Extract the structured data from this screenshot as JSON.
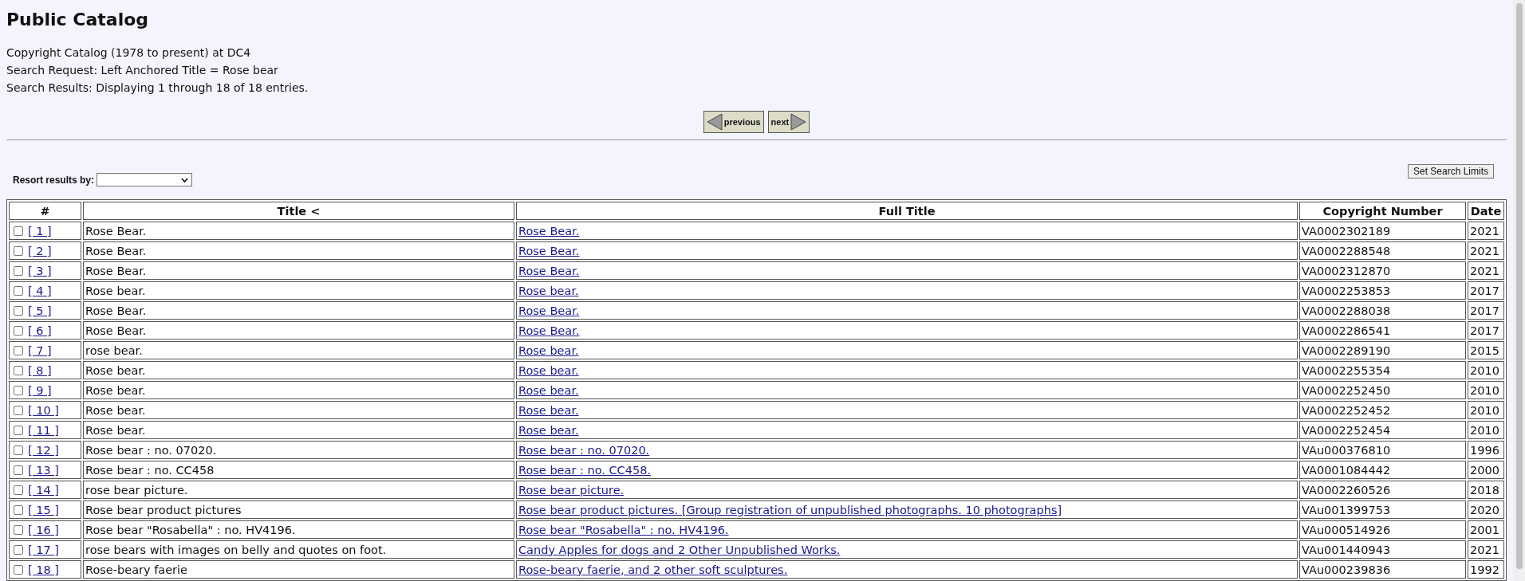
{
  "title": "Public Catalog",
  "info_lines": [
    "Copyright Catalog (1978 to present) at DC4",
    "Search Request: Left Anchored Title = Rose bear",
    "Search Results: Displaying 1 through 18 of 18 entries."
  ],
  "pager": {
    "previous": "previous",
    "next": "next"
  },
  "resort": {
    "label": "Resort results by:"
  },
  "limits_button": "Set Search Limits",
  "table": {
    "columns": [
      "#",
      "Title <",
      "Full Title",
      "Copyright Number",
      "Date"
    ],
    "rows": [
      {
        "checked": false,
        "index": "[ 1 ]",
        "title": "Rose Bear.",
        "full_title": "Rose Bear.",
        "number": "VA0002302189",
        "date": "2021"
      },
      {
        "checked": false,
        "index": "[ 2 ]",
        "title": "Rose Bear.",
        "full_title": "Rose Bear.",
        "number": "VA0002288548",
        "date": "2021"
      },
      {
        "checked": false,
        "index": "[ 3 ]",
        "title": "Rose Bear.",
        "full_title": "Rose Bear.",
        "number": "VA0002312870",
        "date": "2021"
      },
      {
        "checked": false,
        "index": "[ 4 ]",
        "title": "Rose bear.",
        "full_title": "Rose bear.",
        "number": "VA0002253853",
        "date": "2017"
      },
      {
        "checked": false,
        "index": "[ 5 ]",
        "title": "Rose Bear.",
        "full_title": "Rose Bear.",
        "number": "VA0002288038",
        "date": "2017"
      },
      {
        "checked": false,
        "index": "[ 6 ]",
        "title": "Rose Bear.",
        "full_title": "Rose Bear.",
        "number": "VA0002286541",
        "date": "2017"
      },
      {
        "checked": false,
        "index": "[ 7 ]",
        "title": "rose bear.",
        "full_title": "Rose bear.",
        "number": "VA0002289190",
        "date": "2015"
      },
      {
        "checked": false,
        "index": "[ 8 ]",
        "title": "Rose bear.",
        "full_title": "Rose bear.",
        "number": "VA0002255354",
        "date": "2010"
      },
      {
        "checked": false,
        "index": "[ 9 ]",
        "title": "Rose bear.",
        "full_title": "Rose bear.",
        "number": "VA0002252450",
        "date": "2010"
      },
      {
        "checked": false,
        "index": "[ 10 ]",
        "title": "Rose bear.",
        "full_title": "Rose bear.",
        "number": "VA0002252452",
        "date": "2010"
      },
      {
        "checked": false,
        "index": "[ 11 ]",
        "title": "Rose bear.",
        "full_title": "Rose bear.",
        "number": "VA0002252454",
        "date": "2010"
      },
      {
        "checked": false,
        "index": "[ 12 ]",
        "title": "Rose bear : no. 07020.",
        "full_title": "Rose bear : no. 07020.",
        "number": "VAu000376810",
        "date": "1996"
      },
      {
        "checked": false,
        "index": "[ 13 ]",
        "title": "Rose bear : no. CC458",
        "full_title": "Rose bear : no. CC458.",
        "number": "VA0001084442",
        "date": "2000"
      },
      {
        "checked": false,
        "index": "[ 14 ]",
        "title": "rose bear picture.",
        "full_title": "Rose bear picture.",
        "number": "VA0002260526",
        "date": "2018"
      },
      {
        "checked": false,
        "index": "[ 15 ]",
        "title": "Rose bear product pictures",
        "full_title": "Rose bear product pictures. [Group registration of unpublished photographs. 10 photographs]",
        "number": "VAu001399753",
        "date": "2020"
      },
      {
        "checked": false,
        "index": "[ 16 ]",
        "title": "Rose bear \"Rosabella\" : no. HV4196.",
        "full_title": "Rose bear \"Rosabella\" : no. HV4196.",
        "number": "VAu000514926",
        "date": "2001"
      },
      {
        "checked": false,
        "index": "[ 17 ]",
        "title": "rose bears with images on belly and quotes on foot.",
        "full_title": "Candy Apples for dogs and 2 Other Unpublished Works.",
        "number": "VAu001440943",
        "date": "2021"
      },
      {
        "checked": false,
        "index": "[ 18 ]",
        "title": "Rose-beary faerie",
        "full_title": "Rose-beary faerie, and 2 other soft sculptures.",
        "number": "VAu000239836",
        "date": "1992"
      }
    ]
  }
}
